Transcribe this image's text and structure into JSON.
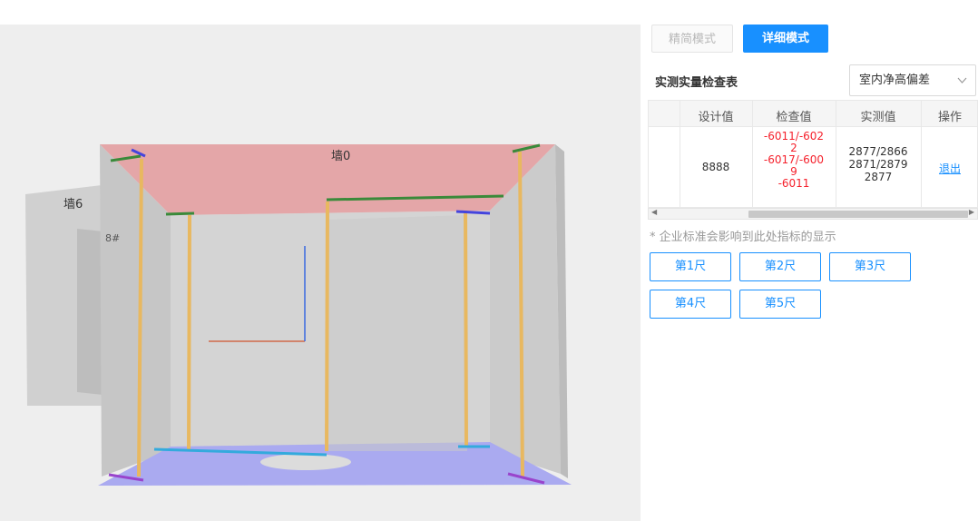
{
  "viewport": {
    "wall_labels": [
      "墙0",
      "墙6",
      "8#"
    ]
  },
  "panel": {
    "mode_simple": "精简模式",
    "mode_detail": "详细模式",
    "table_title": "实测实量检查表",
    "metric_select": "室内净高偏差",
    "columns": [
      "设计值",
      "检查值",
      "实测值",
      "操作"
    ],
    "row": {
      "design": "8888",
      "check_lines": [
        "-6011/-602",
        "2",
        "-6017/-600",
        "9",
        "-6011"
      ],
      "measured_lines": [
        "2877/2866",
        "2871/2879",
        "2877"
      ],
      "action": "退出"
    },
    "note": "* 企业标准会影响到此处指标的显示",
    "rulers": [
      "第1尺",
      "第2尺",
      "第3尺",
      "第4尺",
      "第5尺"
    ]
  },
  "colors": {
    "accent": "#1890ff",
    "error": "#f5222d",
    "ceiling": "#e4a6a8",
    "floor": "#aaaaf0"
  }
}
